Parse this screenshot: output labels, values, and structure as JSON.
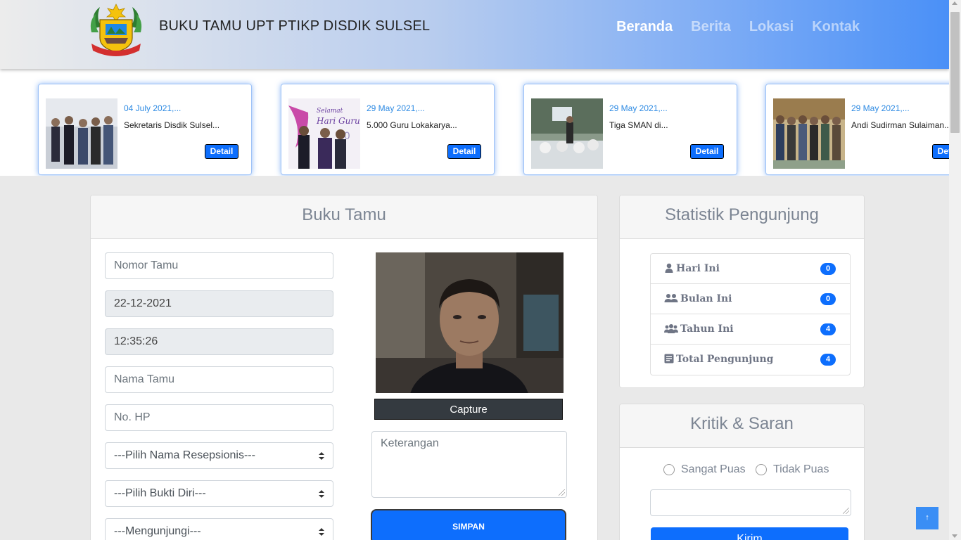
{
  "header": {
    "brand": "BUKU TAMU UPT PTIKP DISDIK SULSEL",
    "nav": [
      {
        "label": "Beranda",
        "active": true
      },
      {
        "label": "Berita",
        "active": false
      },
      {
        "label": "Lokasi",
        "active": false
      },
      {
        "label": "Kontak",
        "active": false
      }
    ]
  },
  "news": [
    {
      "date": "04 July 2021,...",
      "title": "Sekretaris Disdik Sulsel...",
      "button": "Detail"
    },
    {
      "date": "29 May 2021,...",
      "title": "5.000 Guru Lokakarya...",
      "button": "Detail"
    },
    {
      "date": "29 May 2021,...",
      "title": "Tiga SMAN di...",
      "button": "Detail"
    },
    {
      "date": "29 May 2021,...",
      "title": "Andi Sudirman Sulaiman...",
      "button": "Detail"
    }
  ],
  "guestbook": {
    "title": "Buku Tamu",
    "nomor_placeholder": "Nomor Tamu",
    "date_value": "22-12-2021",
    "time_value": "12:35:26",
    "nama_placeholder": "Nama Tamu",
    "hp_placeholder": "No. HP",
    "resepsionis_selected": "---Pilih Nama Resepsionis---",
    "bukti_selected": "---Pilih Bukti Diri---",
    "mengunjungi_selected": "---Mengunjungi---",
    "capture_label": "Capture",
    "keterangan_placeholder": "Keterangan",
    "save_label": "SIMPAN"
  },
  "statistik": {
    "title": "Statistik Pengunjung",
    "items": [
      {
        "label": "Hari Ini",
        "count": "0",
        "icon": "user-icon"
      },
      {
        "label": "Bulan Ini",
        "count": "0",
        "icon": "user-pair-icon"
      },
      {
        "label": "Tahun Ini",
        "count": "4",
        "icon": "users-group-icon"
      },
      {
        "label": "Total Pengunjung",
        "count": "4",
        "icon": "document-icon"
      }
    ]
  },
  "kritik": {
    "title": "Kritik & Saran",
    "option_puas": "Sangat Puas",
    "option_tidak": "Tidak Puas",
    "submit_label": "Kirim"
  },
  "scroll_top_label": "↑",
  "colors": {
    "primary": "#0d6efd",
    "nav_gradient_end": "#4a90f7",
    "news_date": "#2f8be3"
  }
}
